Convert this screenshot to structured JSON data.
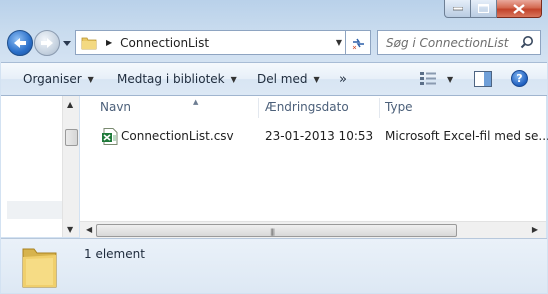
{
  "window": {
    "controls": [
      "minimize",
      "maximize",
      "close"
    ]
  },
  "nav": {
    "address_path": "ConnectionList",
    "search_placeholder": "Søg i ConnectionList"
  },
  "toolbar": {
    "organize_label": "Organiser",
    "library_label": "Medtag i bibliotek",
    "share_label": "Del med",
    "more_label": "»"
  },
  "columns": {
    "name": "Navn",
    "date": "Ændringsdato",
    "type": "Type"
  },
  "files": [
    {
      "name": "ConnectionList.csv",
      "date": "23-01-2013 10:53",
      "type": "Microsoft Excel-fil med se...",
      "icon": "excel-csv-icon"
    }
  ],
  "details": {
    "count": "1 element"
  },
  "colors": {
    "window_frame": "#c8dbee",
    "accent_blue": "#2a6fc9",
    "close_red": "#c2432a",
    "column_header_text": "#4c607a"
  }
}
